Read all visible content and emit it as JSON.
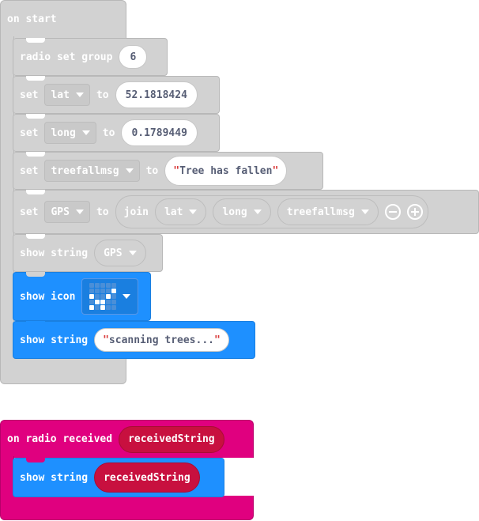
{
  "on_start": {
    "label": "on start",
    "radio_set_group": {
      "label": "radio set group",
      "value": "6"
    },
    "set_lat": {
      "set": "set",
      "variable": "lat",
      "to": "to",
      "value": "52.1818424"
    },
    "set_long": {
      "set": "set",
      "variable": "long",
      "to": "to",
      "value": "0.1789449"
    },
    "set_treefallmsg": {
      "set": "set",
      "variable": "treefallmsg",
      "to": "to",
      "value": "Tree has fallen"
    },
    "set_gps": {
      "set": "set",
      "variable": "GPS",
      "to": "to",
      "join": "join",
      "items": [
        "lat",
        "long",
        "treefallmsg"
      ]
    },
    "show_string_gps": {
      "label": "show string",
      "variable": "GPS"
    },
    "show_icon": {
      "label": "show icon",
      "pattern": [
        [
          0,
          0,
          0,
          0,
          0
        ],
        [
          0,
          0,
          0,
          0,
          1
        ],
        [
          1,
          0,
          0,
          1,
          0
        ],
        [
          0,
          1,
          1,
          0,
          0
        ],
        [
          1,
          0,
          1,
          0,
          0
        ]
      ]
    },
    "show_string_scanning": {
      "label": "show string",
      "value": "scanning trees..."
    }
  },
  "on_radio_received": {
    "label": "on radio received",
    "param": "receivedString",
    "show_string": {
      "label": "show string",
      "value": "receivedString"
    }
  },
  "colors": {
    "gray_block": "#d2d2d2",
    "blue_block": "#1e90ff",
    "pink_block": "#e0007f",
    "variable_red": "#c8103f"
  }
}
